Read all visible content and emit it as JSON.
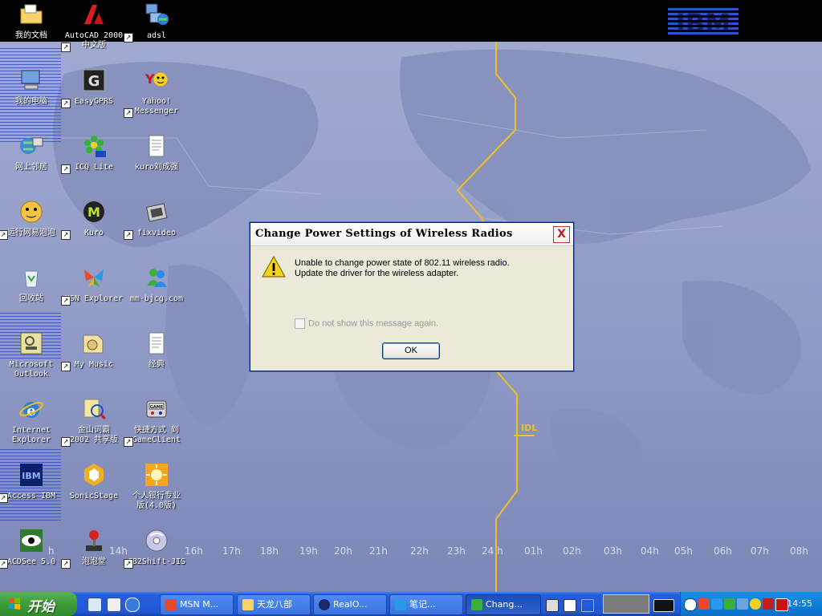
{
  "desktop": {
    "icons": [
      {
        "label": "我的文档"
      },
      {
        "label": "AutoCAD 2000\n中文版"
      },
      {
        "label": "adsl"
      },
      {
        "label": "我的电脑"
      },
      {
        "label": "EasyGPRS"
      },
      {
        "label": "Yahoo!\nMessenger"
      },
      {
        "label": "网上邻居"
      },
      {
        "label": "ICQ Lite"
      },
      {
        "label": "kuro刘成强"
      },
      {
        "label": "运行网易泡泡"
      },
      {
        "label": "Kuro"
      },
      {
        "label": "fixvideo"
      },
      {
        "label": "回收站"
      },
      {
        "label": "MSN Explorer"
      },
      {
        "label": "mm-bjcg.com"
      },
      {
        "label": "Microsoft\nOutlook"
      },
      {
        "label": "My Music"
      },
      {
        "label": "经典"
      },
      {
        "label": "Internet\nExplorer"
      },
      {
        "label": "金山词霸\n2002 共享版"
      },
      {
        "label": "快捷方式 到\nGameClient"
      },
      {
        "label": "Access IBM"
      },
      {
        "label": "SonicStage"
      },
      {
        "label": "个人银行专业\n版(4.0版)"
      },
      {
        "label": "ACDSee 5.0"
      },
      {
        "label": "泡泡堂"
      },
      {
        "label": "GB2Shift-JIS"
      }
    ],
    "timezones": [
      "h",
      "14h",
      "16h",
      "17h",
      "18h",
      "19h",
      "20h",
      "21h",
      "22h",
      "23h",
      "24 h",
      "01h",
      "02h",
      "03h",
      "04h",
      "05h",
      "06h",
      "07h",
      "08h"
    ],
    "idl_label": "IDL",
    "brand": "IBM"
  },
  "dialog": {
    "title": "Change Power Settings of Wireless Radios",
    "close_label": "X",
    "message_line1": "Unable to change power state of 802.11 wireless radio.",
    "message_line2": "Update the driver for the wireless adapter.",
    "checkbox_label": "Do not show this message again.",
    "checkbox_checked": false,
    "ok_label": "OK"
  },
  "taskbar": {
    "start_label": "开始",
    "tasks": [
      {
        "label": "MSN M..."
      },
      {
        "label": "天龙八部"
      },
      {
        "label": "RealO..."
      },
      {
        "label": "笔记..."
      },
      {
        "label": "Chang..."
      }
    ],
    "clock": "14:55"
  },
  "colors": {
    "taskbar_blue": "#245edb",
    "start_green": "#3c9c39",
    "tray_blue": "#0f7fd8",
    "idl_yellow": "#f0c020"
  }
}
